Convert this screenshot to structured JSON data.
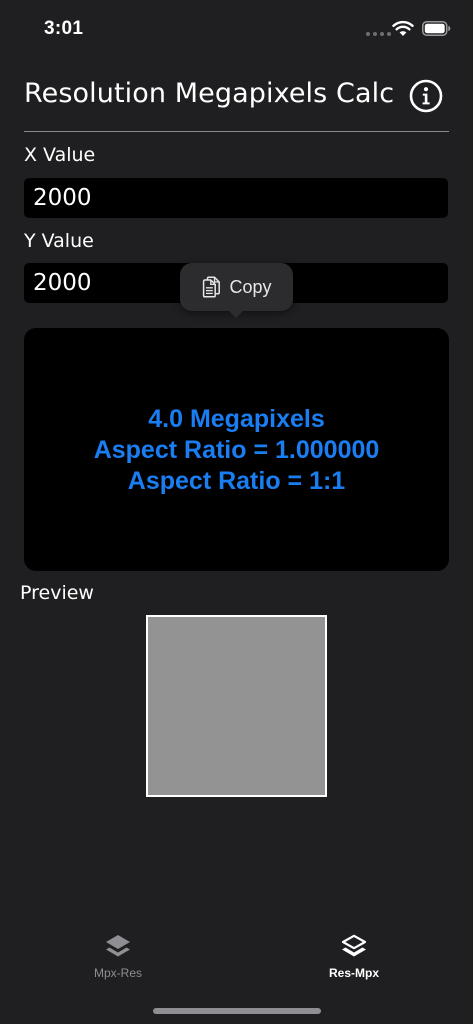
{
  "status_bar": {
    "time": "3:01"
  },
  "header": {
    "title": "Resolution Megapixels Calc",
    "info_icon": "info-circle-icon"
  },
  "form": {
    "x_label": "X Value",
    "x_value": "2000",
    "y_label": "Y Value",
    "y_value": "2000"
  },
  "copy_menu": {
    "label": "Copy",
    "icon": "copy-documents-icon"
  },
  "results": {
    "megapixels": "4.0 Megapixels",
    "aspect_decimal": "Aspect Ratio = 1.000000",
    "aspect_ratio": "Aspect Ratio = 1:1",
    "color": "#1a7ef2"
  },
  "preview": {
    "label": "Preview",
    "fill_color": "#939393"
  },
  "tabs": [
    {
      "label": "Mpx-Res",
      "icon": "layers-icon",
      "selected": false
    },
    {
      "label": "Res-Mpx",
      "icon": "layers-icon",
      "selected": true
    }
  ]
}
